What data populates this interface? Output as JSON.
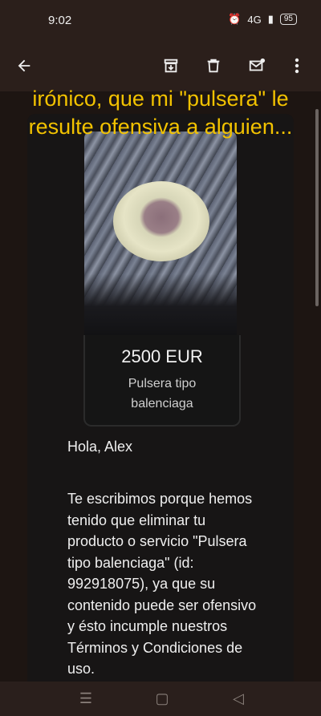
{
  "status_bar": {
    "time": "9:02",
    "signal": "4G",
    "battery": "95"
  },
  "app_bar": {
    "back": "back-arrow",
    "actions": [
      "archive",
      "delete",
      "mark-unread",
      "more"
    ]
  },
  "overlay_caption": "irónico, que mi \"pulsera\" le resulte ofensiva a alguien...",
  "product": {
    "price": "2500 EUR",
    "title": "Pulsera tipo balenciaga"
  },
  "email": {
    "greeting": "Hola, Alex",
    "body": "Te escribimos porque hemos tenido que eliminar tu producto o servicio \"Pulsera tipo balenciaga\" (id: 992918075), ya que su contenido puede ser ofensivo y ésto incumple nuestros Términos y Condiciones de uso."
  },
  "colors": {
    "caption": "#f2c200",
    "background": "#1d1512",
    "card": "#171515"
  }
}
